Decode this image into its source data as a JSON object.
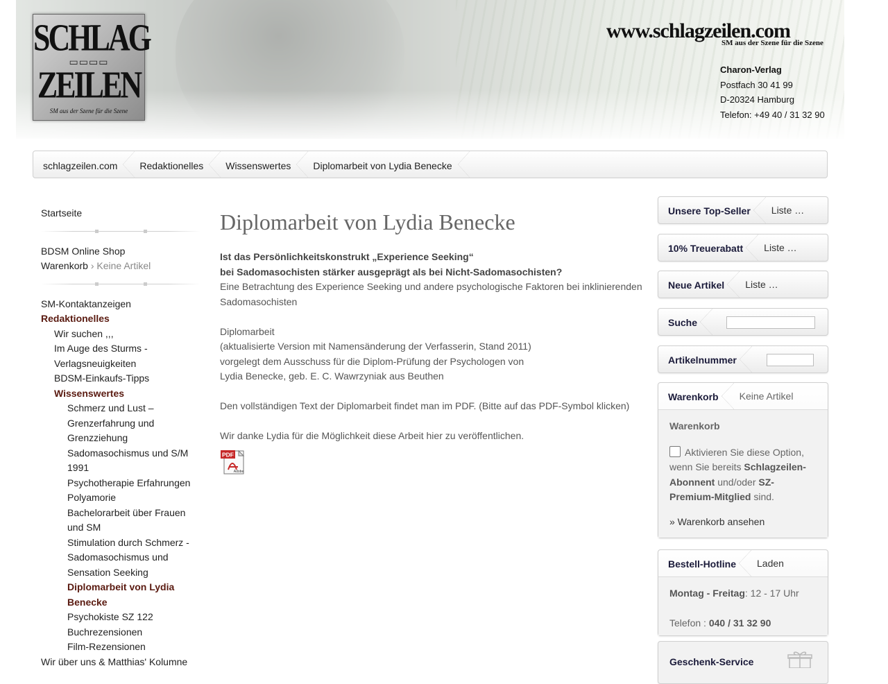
{
  "header": {
    "logo_line1": "SCHLAG",
    "logo_chain": "▭▭▭▭",
    "logo_line2": "ZEILEN",
    "logo_tagline": "SM aus der Szene für die Szene",
    "site_url": "www.schlagzeilen.com",
    "site_tagline": "SM aus der Szene für die Szene",
    "address": {
      "name": "Charon-Verlag",
      "street": "Postfach 30 41 99",
      "city": "D-20324 Hamburg",
      "phone": "Telefon: +49 40 / 31 32 90"
    }
  },
  "breadcrumb": [
    "schlagzeilen.com",
    "Redaktionelles",
    "Wissenswertes",
    "Diplomarbeit von Lydia Benecke"
  ],
  "leftnav": {
    "home": "Startseite",
    "shop": "BDSM Online Shop",
    "cart_label": "Warenkorb",
    "cart_sep": " › ",
    "cart_status": "Keine Artikel",
    "items": [
      {
        "label": "SM-Kontaktanzeigen",
        "level": 0,
        "style": "normal"
      },
      {
        "label": "Redaktionelles",
        "level": 0,
        "style": "section"
      },
      {
        "label": "Wir suchen ,,,",
        "level": 1,
        "style": "normal"
      },
      {
        "label": "Im Auge des Sturms - Verlagsneuigkeiten",
        "level": 1,
        "style": "normal"
      },
      {
        "label": "BDSM-Einkaufs-Tipps",
        "level": 1,
        "style": "normal"
      },
      {
        "label": "Wissenswertes",
        "level": 1,
        "style": "section"
      },
      {
        "label": "Schmerz und Lust – Grenzerfahrung und Grenzziehung",
        "level": 2,
        "style": "normal"
      },
      {
        "label": "Sadomasochismus und S/M 1991",
        "level": 2,
        "style": "normal"
      },
      {
        "label": "Psychotherapie Erfahrungen",
        "level": 2,
        "style": "normal"
      },
      {
        "label": "Polyamorie",
        "level": 2,
        "style": "normal"
      },
      {
        "label": "Bachelorarbeit über Frauen und SM",
        "level": 2,
        "style": "normal"
      },
      {
        "label": "Stimulation durch Schmerz - Sadomasochismus und Sensation Seeking",
        "level": 2,
        "style": "normal"
      },
      {
        "label": "Diplomarbeit von Lydia Benecke",
        "level": 2,
        "style": "current"
      },
      {
        "label": "Psychokiste SZ 122",
        "level": 2,
        "style": "normal"
      },
      {
        "label": "Buchrezensionen",
        "level": 2,
        "style": "normal"
      },
      {
        "label": "Film-Rezensionen",
        "level": 2,
        "style": "normal"
      },
      {
        "label": "Wir über uns & Matthias' Kolumne",
        "level": 0,
        "style": "normal"
      }
    ]
  },
  "main": {
    "title": "Diplomarbeit von Lydia Benecke",
    "intro_bold_1": "Ist das Persönlichkeitskonstrukt „Experience Seeking“",
    "intro_bold_2": "bei Sadomasochisten stärker ausgeprägt als bei Nicht-Sadomasochisten?",
    "intro_text": "Eine Betrachtung des Experience Seeking und andere psychologische Faktoren bei inklinierenden Sadomasochisten",
    "meta_1": "Diplomarbeit",
    "meta_2": "(aktualisierte Version mit Namensänderung der Verfasserin, Stand 2011)",
    "meta_3": "vorgelegt dem Ausschuss für die Diplom-Prüfung der Psychologen von",
    "meta_4": "Lydia Benecke, geb. E. C. Wawrzyniak aus Beuthen",
    "pdf_note": "Den vollständigen Text der Diplomarbeit findet man im PDF. (Bitte auf das PDF-Symbol klicken)",
    "thanks": "Wir danke Lydia für die Möglichkeit diese Arbeit hier zu veröffentlichen.",
    "pdf_icon": "pdf-adobe-icon",
    "pdf_icon_label": "PDF",
    "pdf_icon_brand": "Adobe"
  },
  "sidebar": {
    "topseller": {
      "tab": "Unsere Top-Seller",
      "link": "Liste …"
    },
    "treuerabatt": {
      "tab": "10% Treuerabatt",
      "link": "Liste …"
    },
    "neue_artikel": {
      "tab": "Neue Artikel",
      "link": "Liste …"
    },
    "suche": {
      "tab": "Suche",
      "value": ""
    },
    "artikelnummer": {
      "tab": "Artikelnummer",
      "value": ""
    },
    "warenkorb": {
      "tab": "Warenkorb",
      "status": "Keine Artikel",
      "heading": "Warenkorb",
      "option_pre": "Aktivieren Sie diese Option, wenn Sie bereits",
      "option_b1": "Schlagzeilen-Abonnent",
      "option_mid": "und/oder",
      "option_b2": "SZ-Premium-Mitglied",
      "option_post": "sind.",
      "link": "» Warenkorb ansehen"
    },
    "hotline": {
      "tab": "Bestell-Hotline",
      "link": "Laden",
      "days": "Montag - Freitag",
      "hours": ": 12 - 17 Uhr",
      "phone_label": "Telefon :",
      "phone": "040 / 31 32 90"
    },
    "geschenk": {
      "tab": "Geschenk-Service",
      "icon": "gift-icon"
    }
  },
  "colors": {
    "section_red": "#5a1a10",
    "tab_navy": "#1b1b3a",
    "text_grey": "#555555"
  }
}
